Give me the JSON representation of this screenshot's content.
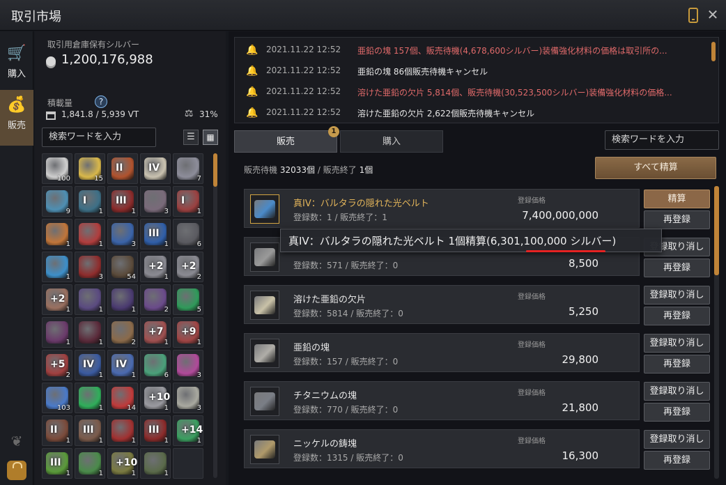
{
  "window": {
    "title": "取引市場",
    "close_glyph": "✕"
  },
  "sidenav": {
    "items": [
      {
        "label": "購入",
        "icon": "cart-icon"
      },
      {
        "label": "販売",
        "icon": "money-bag-icon"
      }
    ]
  },
  "warehouse": {
    "silver_label": "取引用倉庫保有シルバー",
    "silver_value": "1,200,176,988",
    "weight_label": "積載量",
    "weight_value": "1,841.8 / 5,939 VT",
    "percent_value": "31%",
    "search_placeholder": "検索ワードを入力",
    "inventory": [
      {
        "count": "100",
        "color": "#cfcfcf",
        "enh": ""
      },
      {
        "count": "15",
        "color": "#d9b84a",
        "enh": ""
      },
      {
        "count": "",
        "color": "#b0522d",
        "enh": "II"
      },
      {
        "count": "",
        "color": "#c9c2b0",
        "enh": "IV"
      },
      {
        "count": "7",
        "color": "#8d8d9a",
        "enh": ""
      },
      {
        "count": "9",
        "color": "#4e8fb3",
        "enh": ""
      },
      {
        "count": "1",
        "color": "#3d6f86",
        "enh": "I"
      },
      {
        "count": "1",
        "color": "#8a2a2a",
        "enh": "III"
      },
      {
        "count": "3",
        "color": "#7a6a7a",
        "enh": ""
      },
      {
        "count": "1",
        "color": "#9a4040",
        "enh": "I"
      },
      {
        "count": "1",
        "color": "#c0753a",
        "enh": ""
      },
      {
        "count": "1",
        "color": "#b03d3d",
        "enh": ""
      },
      {
        "count": "3",
        "color": "#3a63a8",
        "enh": ""
      },
      {
        "count": "1",
        "color": "#2f5ea8",
        "enh": "III"
      },
      {
        "count": "6",
        "color": "#5a5a60",
        "enh": ""
      },
      {
        "count": "1",
        "color": "#3d8fc9",
        "enh": ""
      },
      {
        "count": "3",
        "color": "#8e2c2c",
        "enh": ""
      },
      {
        "count": "54",
        "color": "#5a4a3a",
        "enh": ""
      },
      {
        "count": "1",
        "color": "#8a8a92",
        "enh": "+2"
      },
      {
        "count": "2",
        "color": "#8a8a92",
        "enh": "+2"
      },
      {
        "count": "1",
        "color": "#9a7060",
        "enh": "+2"
      },
      {
        "count": "1",
        "color": "#5a4a80",
        "enh": ""
      },
      {
        "count": "1",
        "color": "#4a3a70",
        "enh": ""
      },
      {
        "count": "2",
        "color": "#6a4a8a",
        "enh": ""
      },
      {
        "count": "5",
        "color": "#2f9a5a",
        "enh": ""
      },
      {
        "count": "1",
        "color": "#6a3a6a",
        "enh": ""
      },
      {
        "count": "1",
        "color": "#5a2a3a",
        "enh": ""
      },
      {
        "count": "2",
        "color": "#8a6a4a",
        "enh": ""
      },
      {
        "count": "1",
        "color": "#a05050",
        "enh": "+7"
      },
      {
        "count": "1",
        "color": "#a04545",
        "enh": "+9"
      },
      {
        "count": "2",
        "color": "#a04040",
        "enh": "+5"
      },
      {
        "count": "1",
        "color": "#3a5aa0",
        "enh": "IV"
      },
      {
        "count": "1",
        "color": "#4a6ab0",
        "enh": "IV"
      },
      {
        "count": "6",
        "color": "#4aa07a",
        "enh": ""
      },
      {
        "count": "3",
        "color": "#b04a9a",
        "enh": ""
      },
      {
        "count": "103",
        "color": "#4a7ac9",
        "enh": ""
      },
      {
        "count": "1",
        "color": "#2fae5a",
        "enh": ""
      },
      {
        "count": "14",
        "color": "#c03a3a",
        "enh": ""
      },
      {
        "count": "1",
        "color": "#9a9aa0",
        "enh": "+10"
      },
      {
        "count": "3",
        "color": "#a9a9a0",
        "enh": ""
      },
      {
        "count": "1",
        "color": "#7a4a3a",
        "enh": "II"
      },
      {
        "count": "1",
        "color": "#7a5a4a",
        "enh": "III"
      },
      {
        "count": "1",
        "color": "#a03030",
        "enh": ""
      },
      {
        "count": "1",
        "color": "#8a2a2a",
        "enh": "III"
      },
      {
        "count": "1",
        "color": "#3aa060",
        "enh": "+14"
      },
      {
        "count": "1",
        "color": "#5a9a3a",
        "enh": "III"
      },
      {
        "count": "1",
        "color": "#4a8a4a",
        "enh": ""
      },
      {
        "count": "1",
        "color": "#7a7a40",
        "enh": "+10"
      },
      {
        "count": "1",
        "color": "#5a6a4a",
        "enh": ""
      },
      {
        "count": "",
        "color": "#25272d",
        "enh": ""
      }
    ]
  },
  "notifications": [
    {
      "time": "2021.11.22 12:52",
      "text": "亜鉛の塊 157個、販売待機(4,678,600シルバー)装備強化材料の価格は取引所の...",
      "color": "red"
    },
    {
      "time": "2021.11.22 12:52",
      "text": "亜鉛の塊 86個販売待機キャンセル",
      "color": "white"
    },
    {
      "time": "2021.11.22 12:52",
      "text": "溶けた亜鉛の欠片 5,814個、販売待機(30,523,500シルバー)装備強化材料の価格...",
      "color": "red"
    },
    {
      "time": "2021.11.22 12:52",
      "text": "溶けた亜鉛の欠片 2,622個販売待機キャンセル",
      "color": "white"
    }
  ],
  "tabs": {
    "sell": "販売",
    "buy": "購入",
    "sell_badge": "1"
  },
  "right_search_placeholder": "検索ワードを入力",
  "summary": {
    "waiting_label": "販売待機",
    "waiting_value": "32033個",
    "sep": "/",
    "done_label": "販売終了",
    "done_value": "1個"
  },
  "settle_all_label": "すべて精算",
  "price_label": "登録価格",
  "listings": [
    {
      "name": "真IV：バルタラの隠れた光ベルト",
      "counts": "登録数：1 / 販売終了：1",
      "price": "7,400,000,000",
      "btn1": "精算",
      "btn2": "再登録",
      "gold": true,
      "icon_color": "#4a8ac9"
    },
    {
      "name": "",
      "counts": "登録数：571 / 販売終了：0",
      "price": "8,500",
      "btn1": "登録取り消し",
      "btn2": "再登録",
      "gold": false,
      "icon_color": "#9a9a9a"
    },
    {
      "name": "溶けた亜鉛の欠片",
      "counts": "登録数：5814 / 販売終了：0",
      "price": "5,250",
      "btn1": "登録取り消し",
      "btn2": "再登録",
      "gold": false,
      "icon_color": "#c9c2a8"
    },
    {
      "name": "亜鉛の塊",
      "counts": "登録数：157 / 販売終了：0",
      "price": "29,800",
      "btn1": "登録取り消し",
      "btn2": "再登録",
      "gold": false,
      "icon_color": "#b0aea8"
    },
    {
      "name": "チタニウムの塊",
      "counts": "登録数：770 / 販売終了：0",
      "price": "21,800",
      "btn1": "登録取り消し",
      "btn2": "再登録",
      "gold": false,
      "icon_color": "#7a7e86"
    },
    {
      "name": "ニッケルの鋳塊",
      "counts": "登録数：1315 / 販売終了：0",
      "price": "16,300",
      "btn1": "登録取り消し",
      "btn2": "再登録",
      "gold": false,
      "icon_color": "#b09a6a"
    }
  ],
  "tooltip": {
    "text": "真IV：バルタラの隠れた光ベルト 1個精算(6,301,100,000 シルバー)"
  },
  "colors": {
    "accent": "#c08438",
    "sell_tab_active": "#3a3c42",
    "notice_red": "#e06a6a",
    "gold_name": "#e3b55a",
    "highlight_red": "#e52222"
  }
}
